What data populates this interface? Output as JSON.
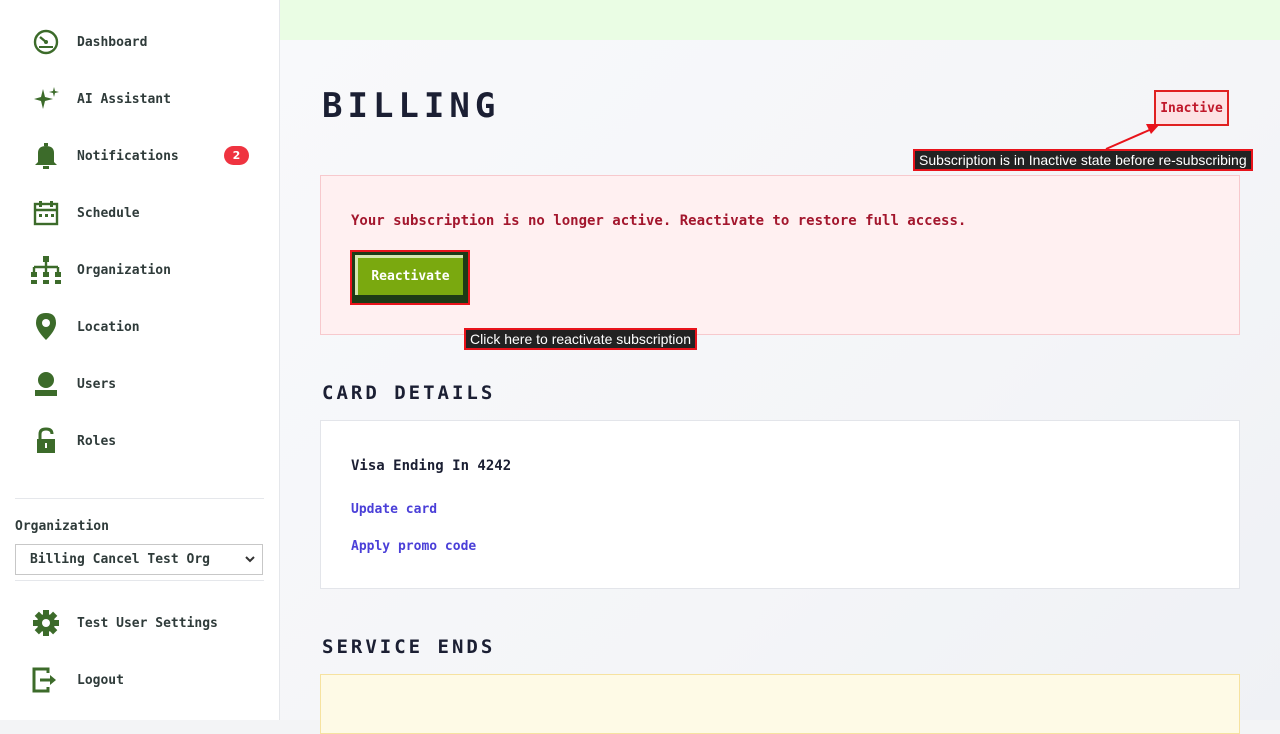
{
  "sidebar": {
    "items": [
      {
        "label": "Dashboard",
        "icon": "dashboard-icon"
      },
      {
        "label": "AI Assistant",
        "icon": "sparkle-icon"
      },
      {
        "label": "Notifications",
        "icon": "bell-icon",
        "badge": "2"
      },
      {
        "label": "Schedule",
        "icon": "calendar-icon"
      },
      {
        "label": "Organization",
        "icon": "org-chart-icon"
      },
      {
        "label": "Location",
        "icon": "location-pin-icon"
      },
      {
        "label": "Users",
        "icon": "user-icon"
      },
      {
        "label": "Roles",
        "icon": "unlock-icon"
      }
    ],
    "organization_label": "Organization",
    "organization_selected": "Billing Cancel Test Org",
    "settings_label": "Test User Settings",
    "logout_label": "Logout"
  },
  "page": {
    "title": "BILLING",
    "status": "Inactive",
    "status_callout": "Subscription is in Inactive state before re-subscribing",
    "alert_message": "Your subscription is no longer active. Reactivate to restore full access.",
    "reactivate_label": "Reactivate",
    "reactivate_callout": "Click here to reactivate subscription"
  },
  "card_details": {
    "heading": "CARD DETAILS",
    "card_title": "Visa Ending In 4242",
    "update_link": "Update card",
    "promo_link": "Apply promo code"
  },
  "service_ends": {
    "heading": "SERVICE ENDS"
  },
  "colors": {
    "accent_green": "#7aa90f",
    "alert_red": "#a3162d",
    "link_purple": "#4a3fd8",
    "badge_red": "#ef3340"
  }
}
